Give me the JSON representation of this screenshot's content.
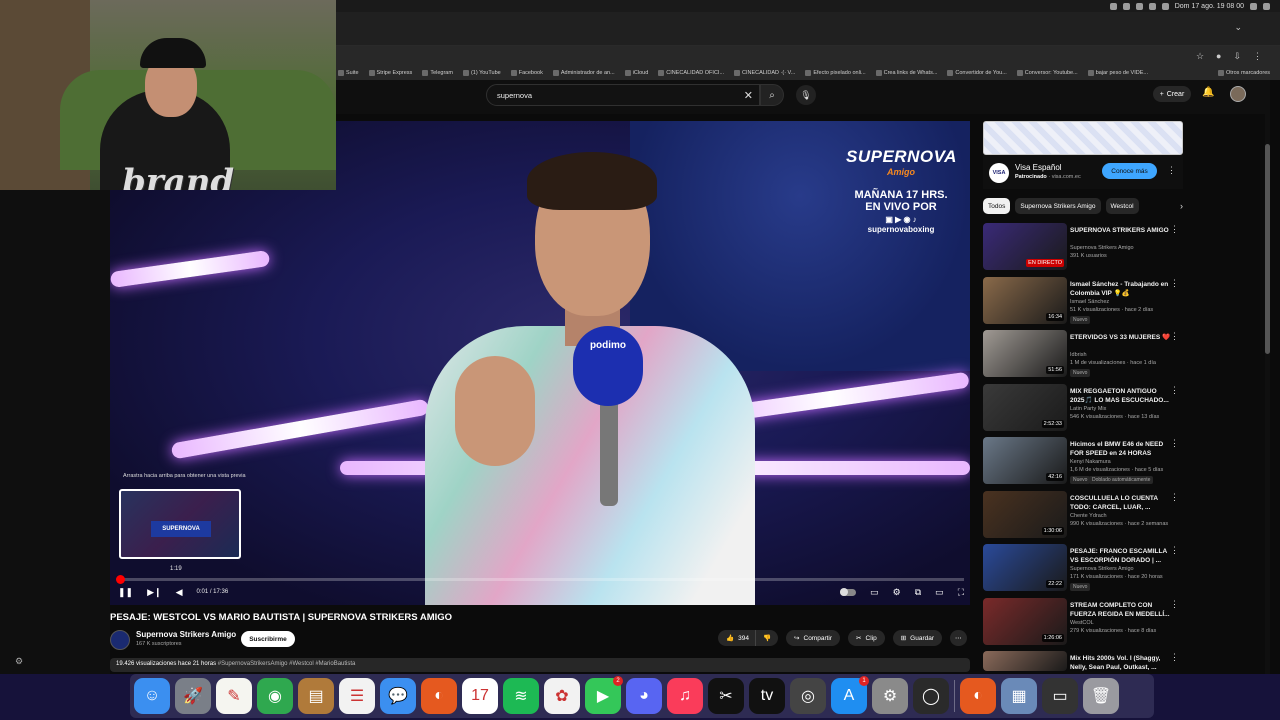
{
  "menubar": {
    "clock": "Dom 17 ago. 19 08 00"
  },
  "bookmarks": [
    "Suite",
    "Stripe Express",
    "Telegram",
    "(1) YouTube",
    "Facebook",
    "Administrador de an...",
    "iCloud",
    "CINECALIDAD OFICI...",
    "CINECALIDAD ·(· V...",
    "Efecto pixelado onli...",
    "Crea links de Whats...",
    "Convertidor de You...",
    "Conversor: Youtube...",
    "bajar peso de VIDE..."
  ],
  "bookmarks_more": "Otros marcadores",
  "search": {
    "value": "supernova",
    "clear_label": "✕"
  },
  "header": {
    "create_label": "Crear"
  },
  "video": {
    "promo_title": "SUPERNOVA",
    "promo_sub": "Amigo",
    "promo_line1": "MAÑANA 17 HRS.",
    "promo_line2": "EN VIVO POR",
    "promo_handle": "supernovaboxing",
    "mic_logo": "podimo",
    "preview_hint": "Arrastra hacia arriba para obtener una vista previa",
    "preview_time": "1:19",
    "time": "0:01 / 17:36",
    "progress": 0.001
  },
  "webcam": {
    "logo": "brand"
  },
  "info": {
    "title": "PESAJE: WESTCOL VS MARIO BAUTISTA | SUPERNOVA STRIKERS AMIGO",
    "channel": "Supernova Strikers Amigo",
    "subs": "167 K suscriptores",
    "subscribe": "Suscribirme",
    "likes": "394",
    "share": "Compartir",
    "clip": "Clip",
    "save": "Guardar",
    "desc_stats": "19.426 visualizaciones  hace 21 horas",
    "desc_tags": "#SupernovaStrikersAmigo #Westcol #MarioBautista"
  },
  "ad": {
    "title": "Visa Español",
    "sponsored": "Patrocinado",
    "domain": "· visa.com.ec",
    "cta": "Conoce más",
    "logo": "VISA"
  },
  "chips": [
    "Todos",
    "Supernova Strikers Amigo",
    "Westcol"
  ],
  "recommendations": [
    {
      "title": "SUPERNOVA STRIKERS AMIGO",
      "channel": "Supernova Strikers Amigo",
      "meta": "391 K usuarios",
      "duration": "EN DIRECTO",
      "live": true,
      "badge": "",
      "thumb": "#3a2a78"
    },
    {
      "title": "Ismael Sánchez - Trabajando en Colombia VIP 💡💰",
      "channel": "Ismael Sánchez",
      "meta": "51 K visualizaciones · hace 2 días",
      "duration": "16:34",
      "live": false,
      "badge": "Nuevo",
      "thumb": "#8a6a4a"
    },
    {
      "title": "ETERVIDOS VS 33 MUJERES ❤️",
      "channel": "Idbrish",
      "meta": "1 M de visualizaciones · hace 1 día",
      "duration": "51:56",
      "live": false,
      "badge": "Nuevo",
      "thumb": "#a09a94"
    },
    {
      "title": "MIX REGGAETON ANTIGUO 2025🎵 LO MAS ESCUCHADO...",
      "channel": "Latin Party Mix",
      "meta": "546 K visualizaciones · hace 13 días",
      "duration": "2:52:33",
      "live": false,
      "badge": "",
      "thumb": "#3a3a3a"
    },
    {
      "title": "Hicimos el BMW E46 de NEED FOR SPEED en 24 HORAS",
      "channel": "Kenyi Nakamura",
      "meta": "1,6 M de visualizaciones · hace 5 días",
      "duration": "42:16",
      "live": false,
      "badge": "Nuevo",
      "badge2": "Doblado automáticamente",
      "thumb": "#6a7888"
    },
    {
      "title": "COSCULLUELA LO CUENTA TODO: CARCEL, LUAR, ...",
      "channel": "Chente Ydrach",
      "meta": "990 K visualizaciones · hace 2 semanas",
      "duration": "1:30:06",
      "live": false,
      "badge": "",
      "thumb": "#4a3220"
    },
    {
      "title": "PESAJE: FRANCO ESCAMILLA VS ESCORPIÓN DORADO | ...",
      "channel": "Supernova Strikers Amigo",
      "meta": "171 K visualizaciones · hace 20 horas",
      "duration": "22:22",
      "live": false,
      "badge": "Nuevo",
      "thumb": "#2a4a9a"
    },
    {
      "title": "STREAM COMPLETO CON FUERZA REGIDA EN MEDELLÍ...",
      "channel": "WestCOL",
      "meta": "279 K visualizaciones · hace 8 días",
      "duration": "1:26:06",
      "live": false,
      "badge": "",
      "thumb": "#7a2a2a"
    },
    {
      "title": "Mix Hits 2000s Vol. I (Shaggy, Nelly, Sean Paul, Outkast, ...",
      "channel": "",
      "meta": "",
      "duration": "",
      "live": false,
      "badge": "",
      "thumb": "#8a6a5a"
    }
  ],
  "dock": [
    {
      "name": "finder",
      "glyph": "☺",
      "color": "#3b8ff0"
    },
    {
      "name": "launchpad",
      "glyph": "🚀",
      "color": "#7a7f88"
    },
    {
      "name": "notes",
      "glyph": "✎",
      "color": "#f5f5f0"
    },
    {
      "name": "chrome",
      "glyph": "◉",
      "color": "#2fa84f"
    },
    {
      "name": "archive",
      "glyph": "▤",
      "color": "#b07a3a"
    },
    {
      "name": "reminders",
      "glyph": "☰",
      "color": "#f2f2f2"
    },
    {
      "name": "messenger",
      "glyph": "💬",
      "color": "#3b8ff0"
    },
    {
      "name": "firefox",
      "glyph": "◐",
      "color": "#e5591f"
    },
    {
      "name": "calendar",
      "glyph": "17",
      "color": "#ffffff"
    },
    {
      "name": "spotify",
      "glyph": "≋",
      "color": "#1db954"
    },
    {
      "name": "photos",
      "glyph": "✿",
      "color": "#f2f2f2"
    },
    {
      "name": "facetime",
      "glyph": "▶",
      "color": "#34c759"
    },
    {
      "name": "discord",
      "glyph": "◕",
      "color": "#5865f2"
    },
    {
      "name": "music",
      "glyph": "♫",
      "color": "#fa3c5a"
    },
    {
      "name": "capcut",
      "glyph": "✂",
      "color": "#111111"
    },
    {
      "name": "appletv",
      "glyph": "tv",
      "color": "#111111"
    },
    {
      "name": "camera",
      "glyph": "◎",
      "color": "#444444"
    },
    {
      "name": "appstore",
      "glyph": "A",
      "color": "#1f8ef1"
    },
    {
      "name": "settings",
      "glyph": "⚙",
      "color": "#8a8a8a"
    },
    {
      "name": "obs",
      "glyph": "◯",
      "color": "#2a2a2a"
    }
  ],
  "dock_right": [
    {
      "name": "firefox2",
      "glyph": "◐",
      "color": "#e5591f"
    },
    {
      "name": "preview",
      "glyph": "▦",
      "color": "#6a8ab8"
    },
    {
      "name": "folder",
      "glyph": "▭",
      "color": "#333333"
    },
    {
      "name": "trash",
      "glyph": "🗑",
      "color": "#9a9aa0"
    }
  ],
  "notif": {
    "facetime": "2",
    "appstore": "1"
  }
}
